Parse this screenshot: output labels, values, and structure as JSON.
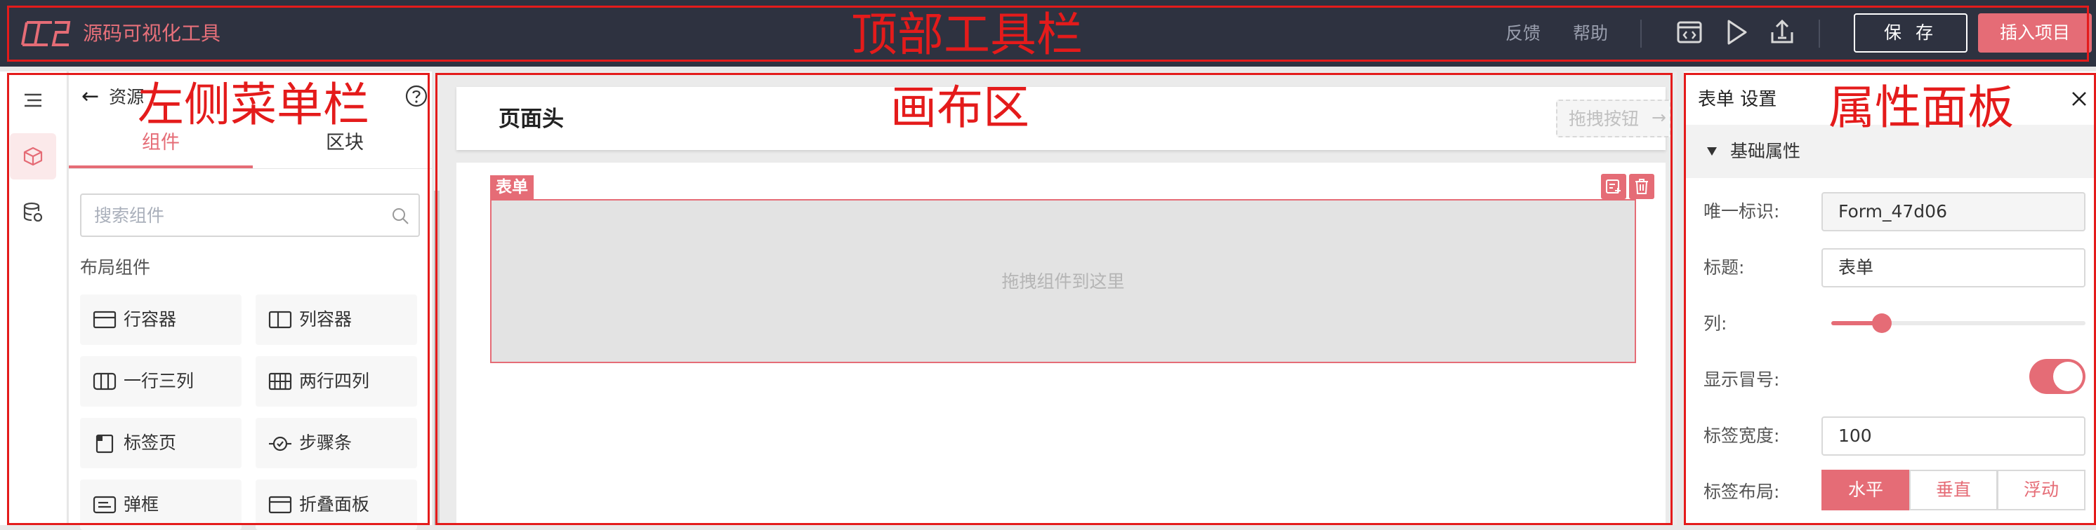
{
  "app": {
    "title": "源码可视化工具"
  },
  "topbar": {
    "feedback": "反馈",
    "help": "帮助",
    "icons": [
      "code-icon",
      "play-icon",
      "export-icon"
    ],
    "save_label": "保 存",
    "insert_label": "插入项目"
  },
  "annotations": {
    "topbar": "顶部工具栏",
    "left_menu": "左侧菜单栏",
    "canvas": "画布区",
    "props": "属性面板"
  },
  "rail": {
    "items": [
      "menu-icon",
      "cube-icon",
      "database-icon"
    ],
    "active_index": 1
  },
  "left_panel": {
    "back_title": "资源",
    "tabs": [
      {
        "label": "组件",
        "active": true
      },
      {
        "label": "区块",
        "active": false
      }
    ],
    "search_placeholder": "搜索组件",
    "section_title": "布局组件",
    "components": [
      {
        "label": "行容器",
        "icon": "row-container-icon"
      },
      {
        "label": "列容器",
        "icon": "column-container-icon"
      },
      {
        "label": "一行三列",
        "icon": "three-columns-icon"
      },
      {
        "label": "两行四列",
        "icon": "grid-icon"
      },
      {
        "label": "标签页",
        "icon": "tabs-icon"
      },
      {
        "label": "步骤条",
        "icon": "steps-icon"
      },
      {
        "label": "弹框",
        "icon": "dialog-icon"
      },
      {
        "label": "折叠面板",
        "icon": "collapse-icon"
      }
    ]
  },
  "canvas": {
    "page_header_title": "页面头",
    "drag_button_label": "拖拽按钮",
    "drag_button_arrow": "→",
    "form_tag": "表单",
    "drop_hint": "拖拽组件到这里"
  },
  "props": {
    "title": "表单 设置",
    "section": "基础属性",
    "fields": {
      "id_label": "唯一标识:",
      "id_value": "Form_47d06",
      "title_label": "标题:",
      "title_value": "表单",
      "columns_label": "列:",
      "columns_slider_fraction": 0.2,
      "colon_label": "显示冒号:",
      "colon_on": true,
      "label_width_label": "标签宽度:",
      "label_width_value": "100",
      "layout_label": "标签布局:",
      "layout_options": [
        "水平",
        "垂直",
        "浮动"
      ],
      "layout_selected": 0
    }
  },
  "colors": {
    "accent": "#e56c76",
    "topbar_bg": "#2e3240",
    "annotation": "#e41b1b"
  }
}
